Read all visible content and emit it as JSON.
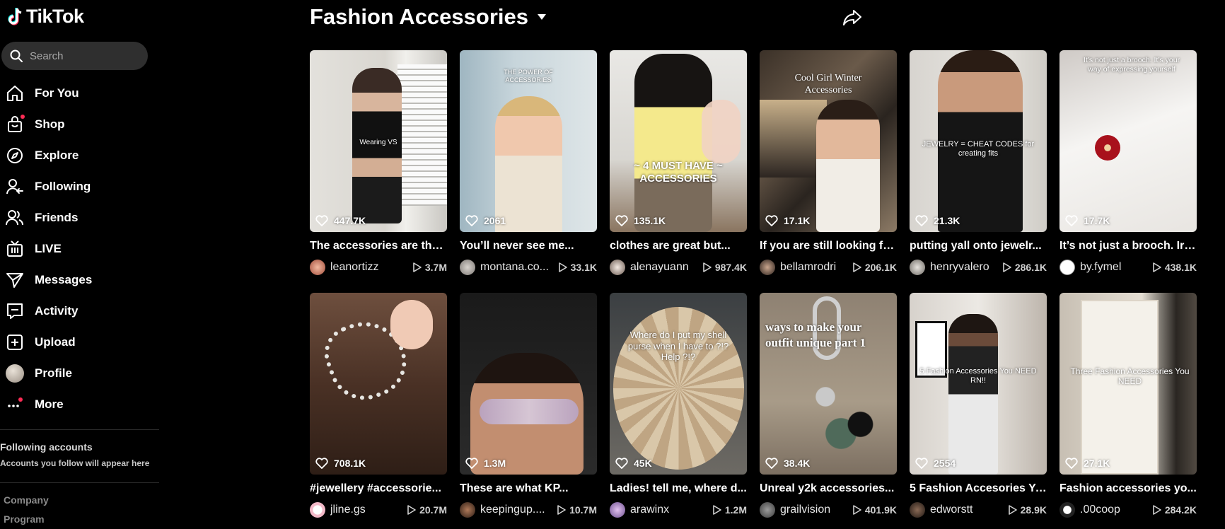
{
  "app": {
    "logo_text": "TikTok"
  },
  "search": {
    "placeholder": "Search"
  },
  "nav": [
    {
      "label": "For You",
      "icon": "home-icon"
    },
    {
      "label": "Shop",
      "icon": "shop-icon"
    },
    {
      "label": "Explore",
      "icon": "compass-icon"
    },
    {
      "label": "Following",
      "icon": "following-icon"
    },
    {
      "label": "Friends",
      "icon": "friends-icon"
    },
    {
      "label": "LIVE",
      "icon": "live-icon"
    },
    {
      "label": "Messages",
      "icon": "messages-icon"
    },
    {
      "label": "Activity",
      "icon": "activity-icon"
    },
    {
      "label": "Upload",
      "icon": "upload-icon"
    },
    {
      "label": "Profile",
      "icon": "avatar"
    },
    {
      "label": "More",
      "icon": "more-icon"
    }
  ],
  "following_accounts": {
    "title": "Following accounts",
    "subtitle": "Accounts you follow will appear here"
  },
  "footer": {
    "company": "Company",
    "program": "Program"
  },
  "header": {
    "title": "Fashion Accessories"
  },
  "videos": [
    {
      "likes": "447.7K",
      "caption": "The accessories are the...",
      "user": "leanortizz",
      "plays": "3.7M",
      "overlay": "Wearing VS"
    },
    {
      "likes": "2061",
      "caption": "You’ll never see me...",
      "user": "montana.co...",
      "plays": "33.1K",
      "overlay": "THE POWER OF ACCESSORIES"
    },
    {
      "likes": "135.1K",
      "caption": "clothes are great but...",
      "user": "alenayuann",
      "plays": "987.4K",
      "overlay": "~ 4 MUST HAVE ~ ACCESSORIES"
    },
    {
      "likes": "17.1K",
      "caption": "If you are still looking fo...",
      "user": "bellamrodri",
      "plays": "206.1K",
      "overlay": "Cool Girl Winter Accessories"
    },
    {
      "likes": "21.3K",
      "caption": "putting yall onto jewelr...",
      "user": "henryvalero",
      "plays": "286.1K",
      "overlay": "JEWELRY = CHEAT CODES for creating fits"
    },
    {
      "likes": "17.7K",
      "caption": "It’s not just a brooch. Iri...",
      "user": "by.fymel",
      "plays": "438.1K",
      "overlay": "It’s not just a brooch. It’s your way of expressing yourself"
    },
    {
      "likes": "708.1K",
      "caption": "#jewellery #accessorie...",
      "user": "jline.gs",
      "plays": "20.7M",
      "overlay": ""
    },
    {
      "likes": "1.3M",
      "caption": "These are what KP...",
      "user": "keepingup....",
      "plays": "10.7M",
      "overlay": ""
    },
    {
      "likes": "45K",
      "caption": "Ladies! tell me, where d...",
      "user": "arawinx",
      "plays": "1.2M",
      "overlay": "Where do I put my shell purse when I have to ?!? Help ?!?"
    },
    {
      "likes": "38.4K",
      "caption": "Unreal y2k accessories...",
      "user": "grailvision",
      "plays": "401.9K",
      "overlay": "ways to make your outfit unique part 1"
    },
    {
      "likes": "2554",
      "caption": "5 Fashion Accesories Yo...",
      "user": "edworstt",
      "plays": "28.9K",
      "overlay": "5 Fashion Accessories You NEED RN!!"
    },
    {
      "likes": "27.1K",
      "caption": "Fashion accessories yo...",
      "user": ".00coop",
      "plays": "284.2K",
      "overlay": "Three Fashion Accessories You NEED"
    }
  ],
  "colors": {
    "accent": "#fe2c55",
    "cyan": "#25f4ee",
    "background": "#000000",
    "search_bg": "#2f2f2f"
  }
}
